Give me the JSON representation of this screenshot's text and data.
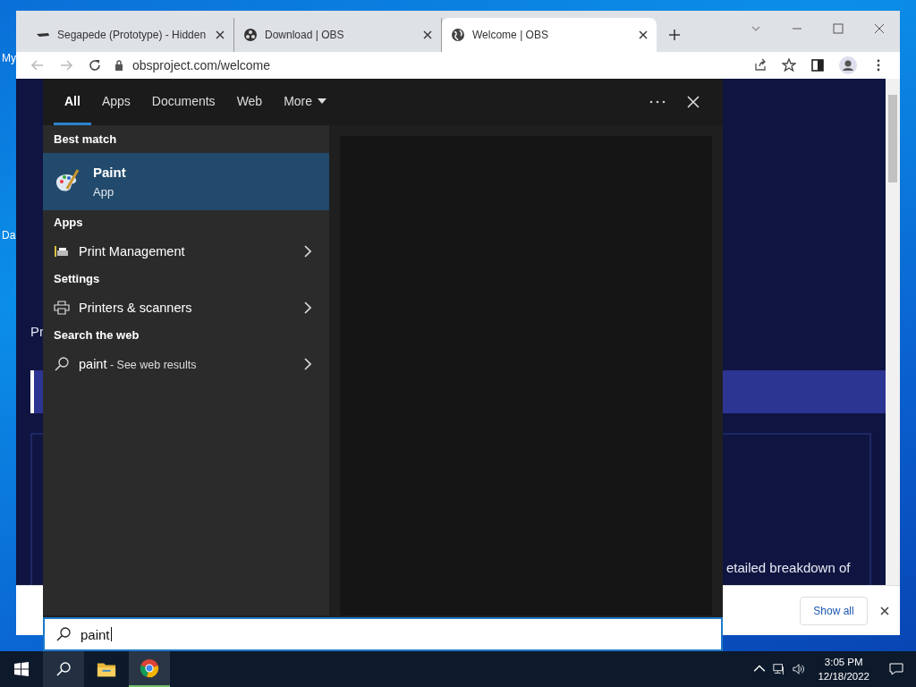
{
  "desktop": {
    "icon_labels": [
      "My",
      "Da"
    ]
  },
  "browser": {
    "tabs": [
      {
        "title": "Segapede (Prototype) - Hidden",
        "selected": false
      },
      {
        "title": "Download | OBS",
        "selected": false
      },
      {
        "title": "Welcome | OBS",
        "selected": true
      }
    ],
    "address": "obsproject.com/welcome",
    "page_fragments": {
      "subtitle": "Pr",
      "text": "etailed breakdown of"
    },
    "download_bar": {
      "show_all": "Show all"
    }
  },
  "search_panel": {
    "tabs": [
      {
        "label": "All",
        "selected": true
      },
      {
        "label": "Apps",
        "selected": false
      },
      {
        "label": "Documents",
        "selected": false
      },
      {
        "label": "Web",
        "selected": false
      },
      {
        "label": "More",
        "selected": false
      }
    ],
    "results": [
      {
        "kind": "header",
        "label": "Best match"
      },
      {
        "kind": "best",
        "label": "Paint",
        "sub": "App",
        "selected": true
      },
      {
        "kind": "header",
        "label": "Apps"
      },
      {
        "kind": "item",
        "label": "Print Management",
        "selected": false
      },
      {
        "kind": "header",
        "label": "Settings"
      },
      {
        "kind": "item",
        "label": "Printers & scanners",
        "selected": false
      },
      {
        "kind": "header",
        "label": "Search the web"
      },
      {
        "kind": "web",
        "label": "paint",
        "sub": "- See web results",
        "selected": false
      }
    ],
    "query": "paint"
  },
  "taskbar": {
    "apps": [
      {
        "kind": "explorer",
        "active": false
      },
      {
        "kind": "chrome",
        "active": true
      }
    ],
    "time": "3:05 PM",
    "date": "12/18/2022"
  }
}
